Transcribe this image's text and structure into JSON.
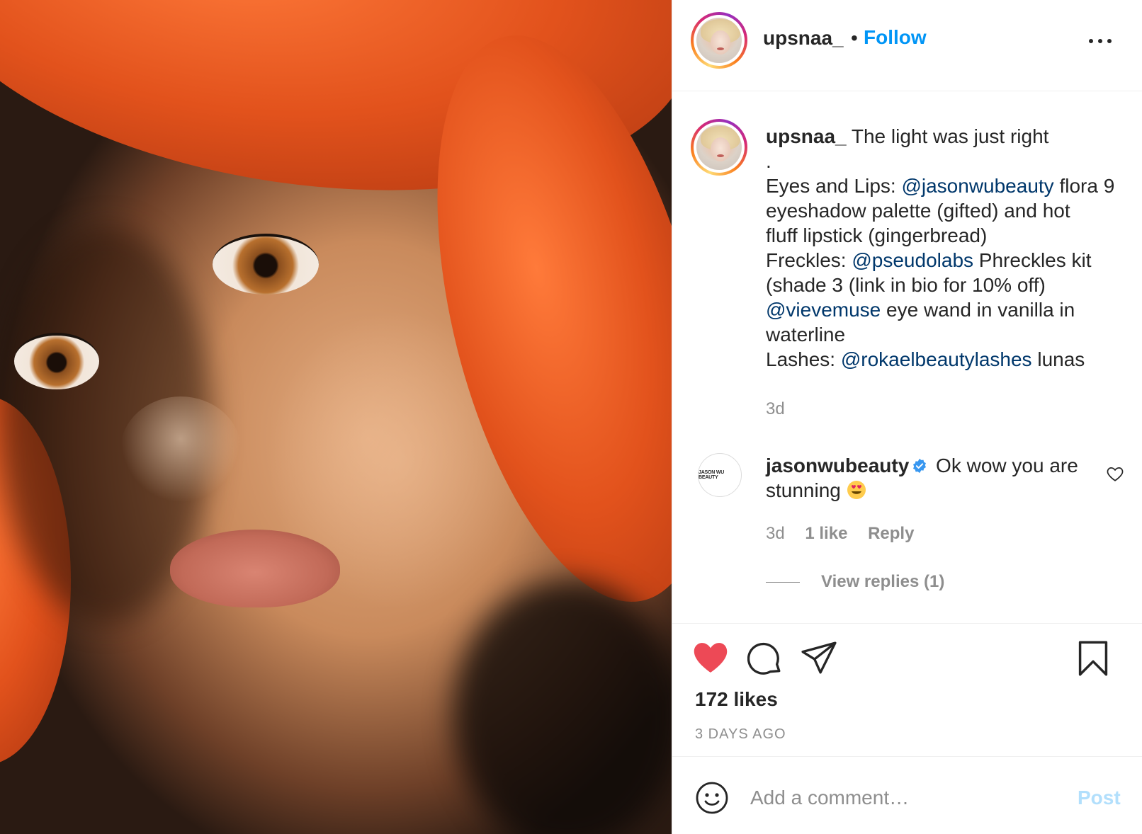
{
  "post": {
    "author": "upsnaa_",
    "follow_label": "Follow",
    "separator": "•",
    "caption": {
      "author": "upsnaa_",
      "lines": [
        {
          "before": " The light was just right",
          "mention": "",
          "after": ""
        },
        {
          "before": ".",
          "mention": "",
          "after": ""
        },
        {
          "before": "Eyes and Lips: ",
          "mention": "@jasonwubeauty",
          "after": " flora 9"
        },
        {
          "before": "eyeshadow palette (gifted) and hot",
          "mention": "",
          "after": ""
        },
        {
          "before": "fluff lipstick (gingerbread)",
          "mention": "",
          "after": ""
        },
        {
          "before": "Freckles: ",
          "mention": "@pseudolabs",
          "after": " Phreckles kit"
        },
        {
          "before": "(shade 3 (link in bio for 10% off)",
          "mention": "",
          "after": ""
        },
        {
          "before": "",
          "mention": "@vievemuse",
          "after": " eye wand in vanilla in"
        },
        {
          "before": "waterline",
          "mention": "",
          "after": ""
        },
        {
          "before": "Lashes: ",
          "mention": "@rokaelbeautylashes",
          "after": " lunas"
        }
      ],
      "time": "3d"
    },
    "comment": {
      "author": "jasonwubeauty",
      "avatar_text": "JASON WU BEAUTY",
      "line1": " Ok wow you are",
      "line2": "stunning ",
      "time": "3d",
      "likes": "1 like",
      "reply_label": "Reply",
      "view_replies": "View replies (1)"
    },
    "likes": "172 likes",
    "date": "3 DAYS AGO",
    "liked": true
  },
  "add_comment": {
    "placeholder": "Add a comment…",
    "post_label": "Post"
  },
  "colors": {
    "accent": "#0095f6",
    "mention": "#00376b",
    "like": "#ed4956",
    "muted": "#8e8e8e",
    "post_disabled": "#b2dffc"
  },
  "icons": [
    "more-options-icon",
    "verified-badge-icon",
    "heart-eyes-emoji",
    "heart-outline-icon",
    "heart-filled-icon",
    "comment-icon",
    "share-icon",
    "bookmark-icon",
    "smiley-icon"
  ]
}
